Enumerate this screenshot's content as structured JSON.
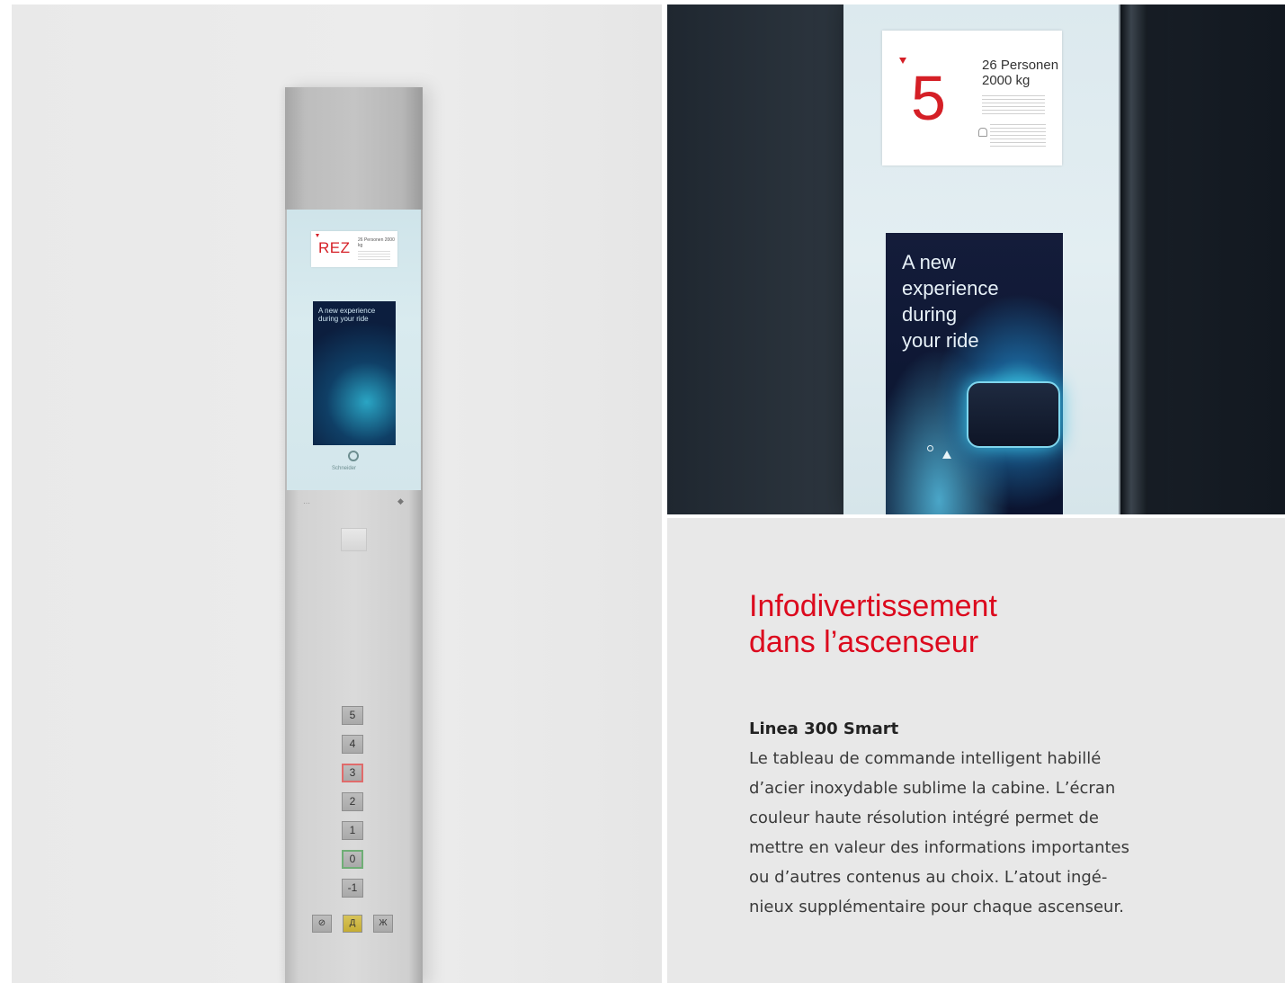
{
  "left_panel": {
    "screen_floor": "REZ",
    "screen_caption": "26 Personen 2000 kg",
    "screen_ad_text": "A new experience during your ride",
    "brand": "Schneider",
    "floor_buttons": [
      "5",
      "4",
      "3",
      "2",
      "1",
      "0",
      "-1"
    ],
    "active_floor": "3",
    "home_floor": "0",
    "bottom_buttons": [
      "⊘",
      "Д",
      "Ж"
    ]
  },
  "right_photo": {
    "floor": "5",
    "caption_line1": "26 Personen",
    "caption_line2": "2000 kg",
    "ad_text": [
      "A new",
      "experience",
      "during",
      "your ride"
    ]
  },
  "text": {
    "headline": [
      "Infodivertissement",
      "dans l’ascenseur"
    ],
    "product_name": "Linea 300 Smart",
    "description": [
      "Le tableau de commande intelligent habillé",
      "d’acier inoxydable sublime la cabine. L’écran",
      "couleur haute résolution intégré permet de",
      "mettre en valeur des informations importantes",
      "ou d’autres contenus au choix. L’atout ingé-",
      "nieux supplémentaire pour chaque ascenseur."
    ]
  },
  "colors": {
    "accent_red": "#dc0a1e",
    "text_gray": "#3a3a3a",
    "background_gray": "#e8e8e8"
  }
}
